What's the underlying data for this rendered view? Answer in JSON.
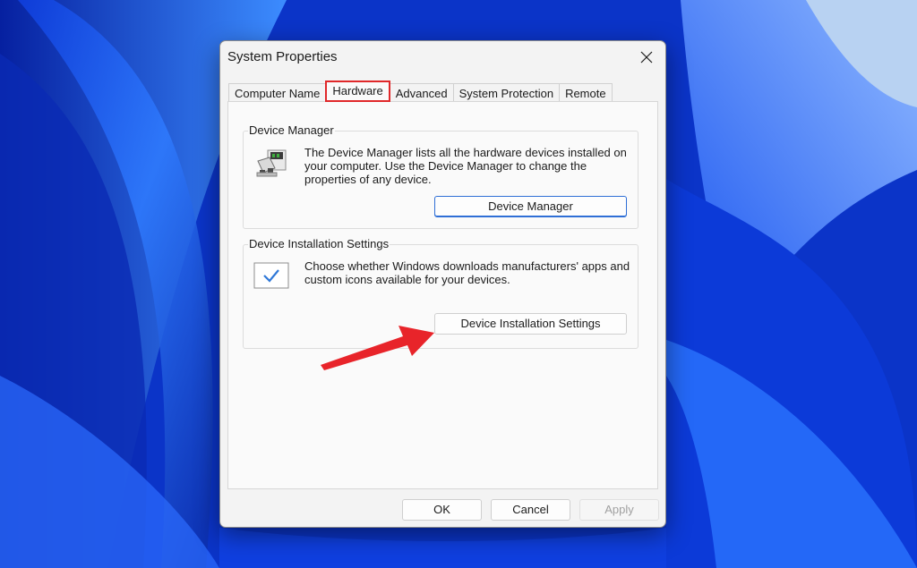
{
  "dialog": {
    "title": "System Properties",
    "close_icon": "close-icon"
  },
  "tabs": [
    {
      "label": "Computer Name",
      "active": false
    },
    {
      "label": "Hardware",
      "active": true
    },
    {
      "label": "Advanced",
      "active": false
    },
    {
      "label": "System Protection",
      "active": false
    },
    {
      "label": "Remote",
      "active": false
    }
  ],
  "device_manager": {
    "group_label": "Device Manager",
    "description": "The Device Manager lists all the hardware devices installed on your computer. Use the Device Manager to change the properties of any device.",
    "button_label": "Device Manager",
    "icon": "device-manager-icon"
  },
  "device_installation": {
    "group_label": "Device Installation Settings",
    "description": "Choose whether Windows downloads manufacturers' apps and custom icons available for your devices.",
    "button_label": "Device Installation Settings",
    "icon": "checkmark-icon"
  },
  "footer": {
    "ok_label": "OK",
    "cancel_label": "Cancel",
    "apply_label": "Apply"
  },
  "colors": {
    "highlight": "#e0282a",
    "arrow": "#e8242a",
    "accent": "#2f6fd6"
  }
}
